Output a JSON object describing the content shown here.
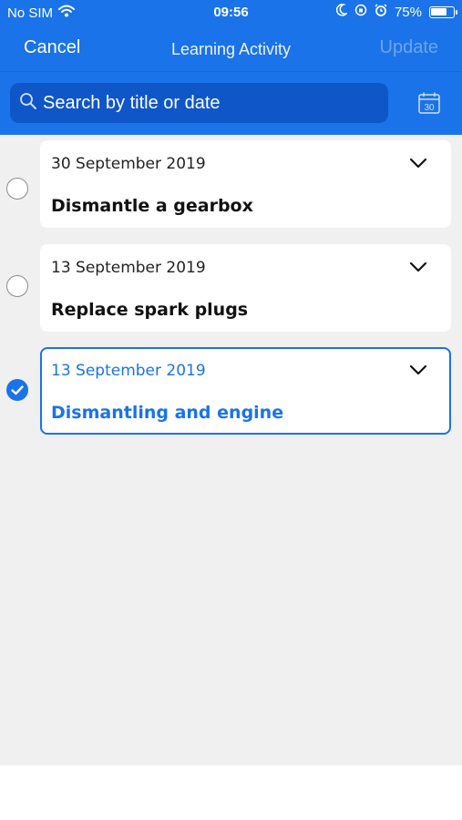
{
  "status_bar": {
    "carrier": "No SIM",
    "time": "09:56",
    "battery": "75%",
    "battery_level": 0.75
  },
  "nav": {
    "cancel_label": "Cancel",
    "title": "Learning Activity",
    "update_label": "Update"
  },
  "search": {
    "placeholder": "Search by title or date",
    "calendar_day": "30"
  },
  "activities": [
    {
      "date": "30 September 2019",
      "title": "Dismantle a gearbox",
      "selected": false
    },
    {
      "date": "13 September 2019",
      "title": "Replace spark plugs",
      "selected": false
    },
    {
      "date": "13 September 2019",
      "title": "Dismantling and engine",
      "selected": true
    }
  ],
  "colors": {
    "accent": "#1a73e8",
    "search_bg": "#0f56c9",
    "list_bg": "#f0f0f0"
  }
}
